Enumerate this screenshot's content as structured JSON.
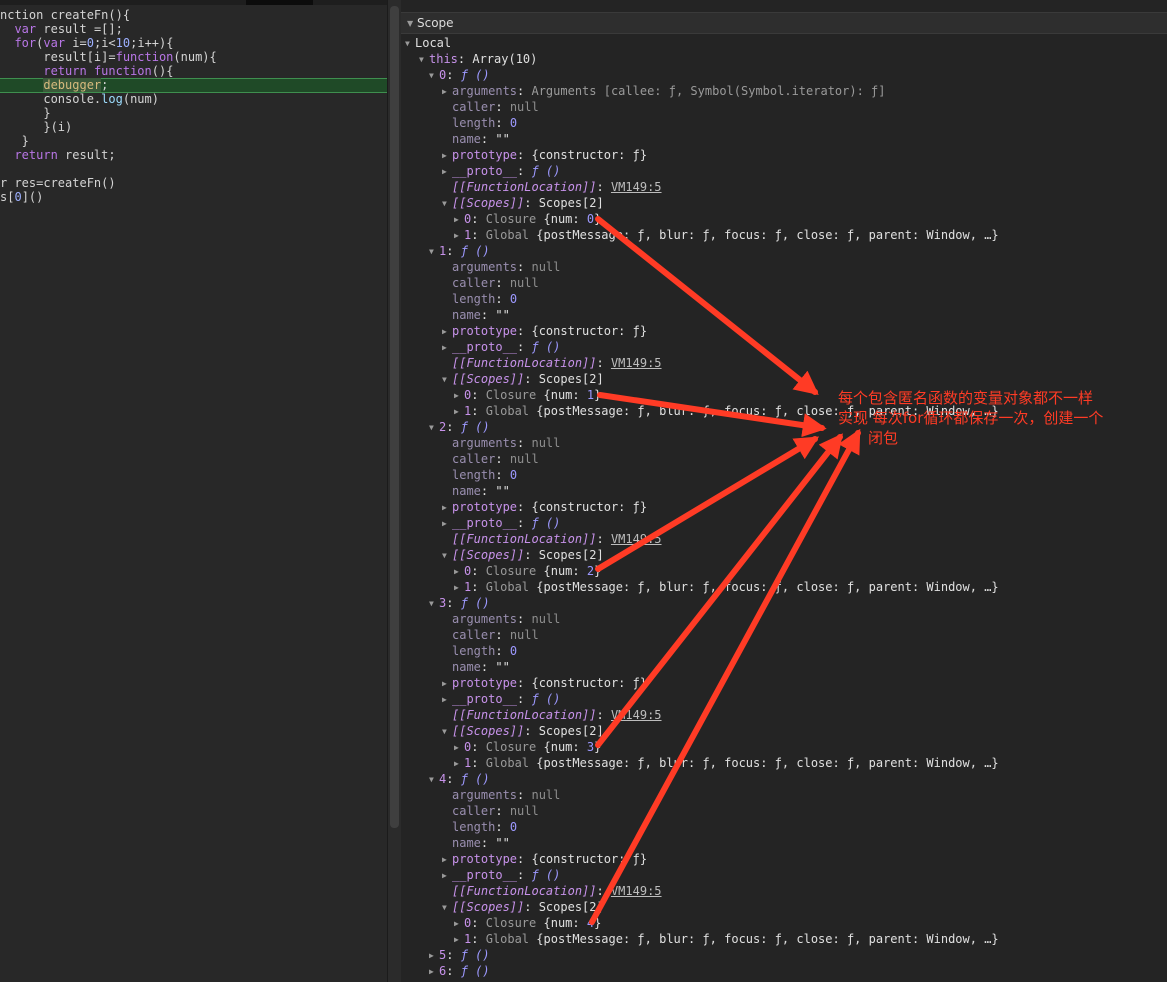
{
  "editor": {
    "lines": [
      "nction createFn(){",
      "  var result =[];",
      "  for(var i=0;i<10;i++){",
      "      result[i]=function(num){",
      "      return function(){",
      "      debugger;",
      "      console.log(num)",
      "      }",
      "      }(i)",
      "   }",
      "  return result;",
      "",
      "r res=createFn()",
      "s[0]()"
    ]
  },
  "scope": {
    "section_title": "Scope",
    "local_label": "Local",
    "this_key": "this",
    "this_value": "Array(10)",
    "items": [
      {
        "index": "0",
        "expanded": true,
        "arguments_value": "Arguments [callee: ƒ, Symbol(Symbol.iterator): ƒ]",
        "closure_num": "0"
      },
      {
        "index": "1",
        "expanded": true,
        "arguments_value": "null",
        "closure_num": "1"
      },
      {
        "index": "2",
        "expanded": true,
        "arguments_value": "null",
        "closure_num": "2"
      },
      {
        "index": "3",
        "expanded": true,
        "arguments_value": "null",
        "closure_num": "3"
      },
      {
        "index": "4",
        "expanded": true,
        "arguments_value": "null",
        "closure_num": "4"
      },
      {
        "index": "5",
        "expanded": false
      },
      {
        "index": "6",
        "expanded": false
      }
    ],
    "fn_value": "ƒ ()",
    "caller_key": "caller",
    "caller_value": "null",
    "length_key": "length",
    "length_value": "0",
    "name_key": "name",
    "name_value": "\"\"",
    "prototype_key": "prototype",
    "prototype_value": "{constructor: ƒ}",
    "proto_key": "__proto__",
    "proto_value": "ƒ ()",
    "fnloc_key": "[[FunctionLocation]]",
    "fnloc_value": "VM149:5",
    "scopes_key": "[[Scopes]]",
    "scopes_value": "Scopes[2]",
    "closure_label": "Closure",
    "global_label": "Global",
    "global_value": "{postMessage: ƒ, blur: ƒ, focus: ƒ, close: ƒ, parent: Window, …}"
  },
  "annotation": {
    "line1": "每个包含匿名函数的变量对象都不一样",
    "line2": "实现 每次for循环都保存一次，创建一个",
    "line3": "闭包",
    "color": "#ff3b25"
  }
}
